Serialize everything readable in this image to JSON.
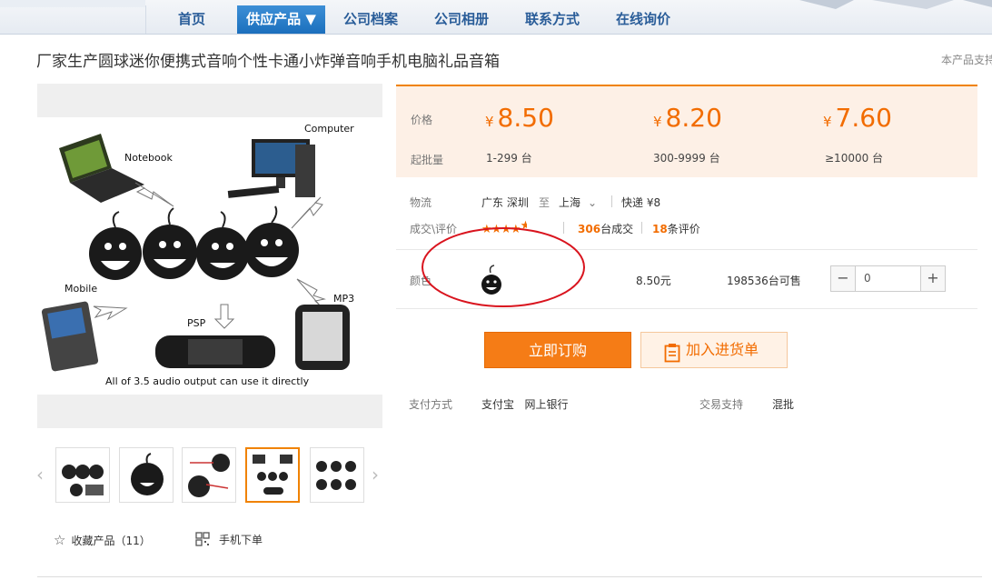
{
  "nav": {
    "items": [
      "首页",
      "供应产品 ▼",
      "公司档案",
      "公司相册",
      "联系方式",
      "在线询价"
    ],
    "active_index": 1
  },
  "product": {
    "title": "厂家生产圆球迷你便携式音响个性卡通小炸弹音响手机电脑礼品音箱",
    "support_text": "本产品支持",
    "image_caption": "All of 3.5 audio output can use it directly",
    "image_labels": {
      "notebook": "Notebook",
      "computer": "Computer",
      "mobile": "Mobile",
      "psp": "PSP",
      "mp3": "MP3"
    }
  },
  "pricing": {
    "price_label": "价格",
    "moq_label": "起批量",
    "currency": "¥",
    "tiers": [
      {
        "price": "8.50",
        "qty": "1-299 台"
      },
      {
        "price": "8.20",
        "qty": "300-9999 台"
      },
      {
        "price": "7.60",
        "qty": "≥10000 台"
      }
    ]
  },
  "logistics": {
    "label": "物流",
    "from": "广东 深圳",
    "to_sep": "至",
    "to": "上海",
    "express": "快递 ¥8"
  },
  "reviews": {
    "label": "成交\\评价",
    "rating": 4.5,
    "deals_count": "306",
    "deals_suffix": "台成交",
    "review_count": "18",
    "review_suffix": "条评价"
  },
  "variant": {
    "label": "颜色",
    "price": "8.50元",
    "stock": "198536台可售",
    "quantity": "0",
    "minus": "−",
    "plus": "+"
  },
  "actions": {
    "order": "立即订购",
    "add_to_cart": "加入进货单"
  },
  "payment": {
    "label": "支付方式",
    "methods": "支付宝   网上银行",
    "trade_label": "交易支持",
    "trade_value": "混批"
  },
  "footer": {
    "favorite": "收藏产品（11）",
    "mobile_order": "手机下单"
  },
  "colors": {
    "accent_orange": "#f26c00",
    "nav_blue": "#1b6fbd",
    "annotation_red": "#d9141e"
  }
}
